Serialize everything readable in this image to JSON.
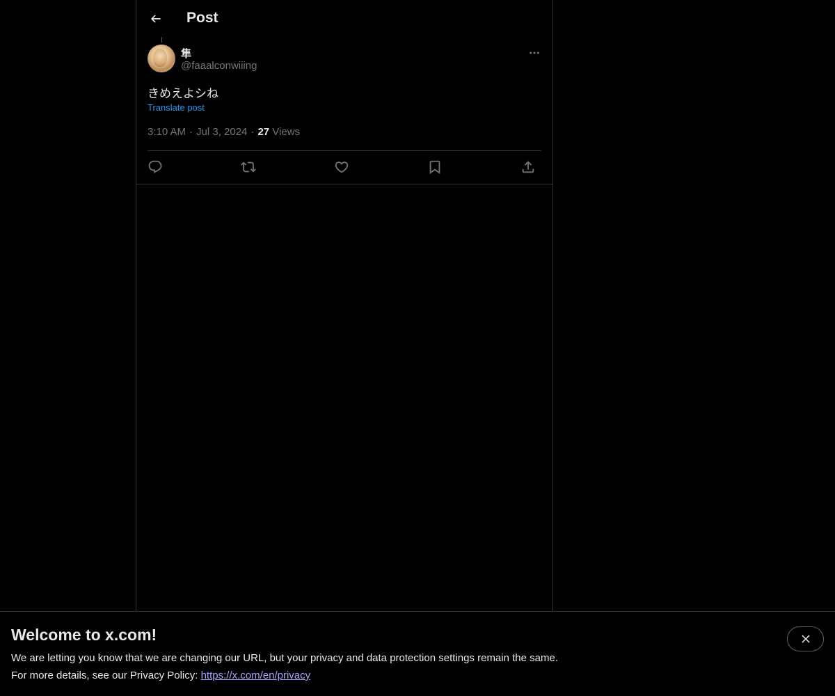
{
  "header": {
    "back_icon": "arrow-left-icon",
    "title": "Post"
  },
  "post": {
    "author": {
      "display_name": "隼",
      "handle": "@faaalconwiiing",
      "avatar": "avatar-image"
    },
    "more_icon": "more-horizontal-icon",
    "text": "きめえよシね",
    "translate_label": "Translate post",
    "time": "3:10 AM",
    "date": "Jul 3, 2024",
    "separator": "·",
    "views_count": "27",
    "views_label": "Views"
  },
  "actions": [
    {
      "name": "reply",
      "icon": "reply-icon"
    },
    {
      "name": "repost",
      "icon": "repost-icon"
    },
    {
      "name": "like",
      "icon": "heart-icon"
    },
    {
      "name": "bookmark",
      "icon": "bookmark-icon"
    },
    {
      "name": "share",
      "icon": "share-icon"
    }
  ],
  "banner": {
    "title": "Welcome to x.com!",
    "line1": "We are letting you know that we are changing our URL, but your privacy and data protection settings remain the same.",
    "line2_prefix": "For more details, see our Privacy Policy: ",
    "link_text": "https://x.com/en/privacy",
    "close_icon": "close-icon"
  },
  "colors": {
    "background": "#000000",
    "text_primary": "#e7e9ea",
    "text_secondary": "#71767b",
    "accent": "#1d9bf0",
    "border": "#2f3336",
    "link_banner": "#a6a2ff"
  }
}
